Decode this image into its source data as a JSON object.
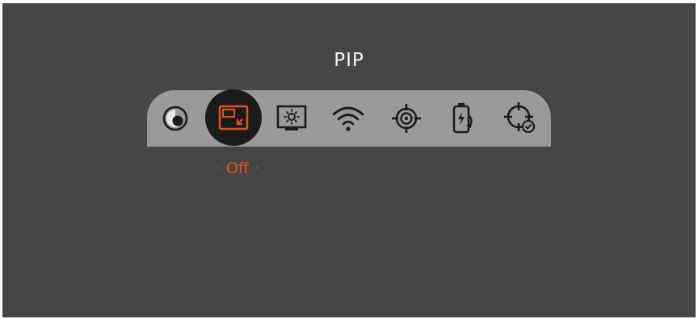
{
  "menu": {
    "title": "PIP",
    "selected_value": "Off",
    "value_left_arrow": "‹",
    "value_right_arrow": "›",
    "items": [
      {
        "name": "color-mode-icon"
      },
      {
        "name": "pip-icon",
        "selected": true
      },
      {
        "name": "brightness-display-icon"
      },
      {
        "name": "wifi-icon"
      },
      {
        "name": "reticle-icon"
      },
      {
        "name": "battery-charging-icon"
      },
      {
        "name": "reticle-check-icon"
      }
    ]
  },
  "colors": {
    "background": "#464646",
    "bar": "#9a9a9a",
    "selected_bubble": "#1b1b1b",
    "accent": "#e0521c",
    "icon": "#1b1b1b",
    "title": "#f4f4f4"
  }
}
